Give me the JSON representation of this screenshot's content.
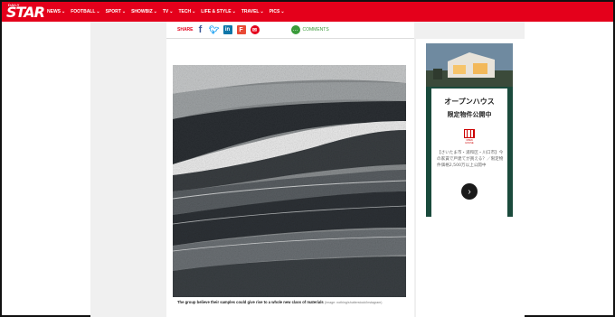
{
  "brand": {
    "logo_top": "DAILY",
    "logo_main": "STAR",
    "accent": "#e4001b"
  },
  "nav": {
    "items": [
      {
        "label": "NEWS",
        "dropdown": true
      },
      {
        "label": "FOOTBALL",
        "dropdown": true
      },
      {
        "label": "SPORT",
        "dropdown": true
      },
      {
        "label": "SHOWBIZ",
        "dropdown": true
      },
      {
        "label": "TV",
        "dropdown": true
      },
      {
        "label": "TECH",
        "dropdown": true
      },
      {
        "label": "LIFE & STYLE",
        "dropdown": true
      },
      {
        "label": "TRAVEL",
        "dropdown": true
      },
      {
        "label": "PICS",
        "dropdown": true
      }
    ],
    "chevron": "⌄"
  },
  "share": {
    "label": "SHARE",
    "icons": [
      "facebook-icon",
      "twitter-icon",
      "linkedin-icon",
      "flipboard-icon",
      "email-icon"
    ],
    "comments_label": "COMMENTS"
  },
  "article": {
    "caption": "The group believe their samples could give rise to a whole new class of materials",
    "credit": "(Image: nothing/shutterstock/Instagram)"
  },
  "ad": {
    "title_line1": "オープンハウス",
    "title_line2": "限定物件公開中",
    "logo_text": "OPEN HOUSE",
    "body": "【さいたま市・浦和区・川口市】今の家賃で戸建てが買える？／限定物件価格2,500万以上公開中"
  }
}
